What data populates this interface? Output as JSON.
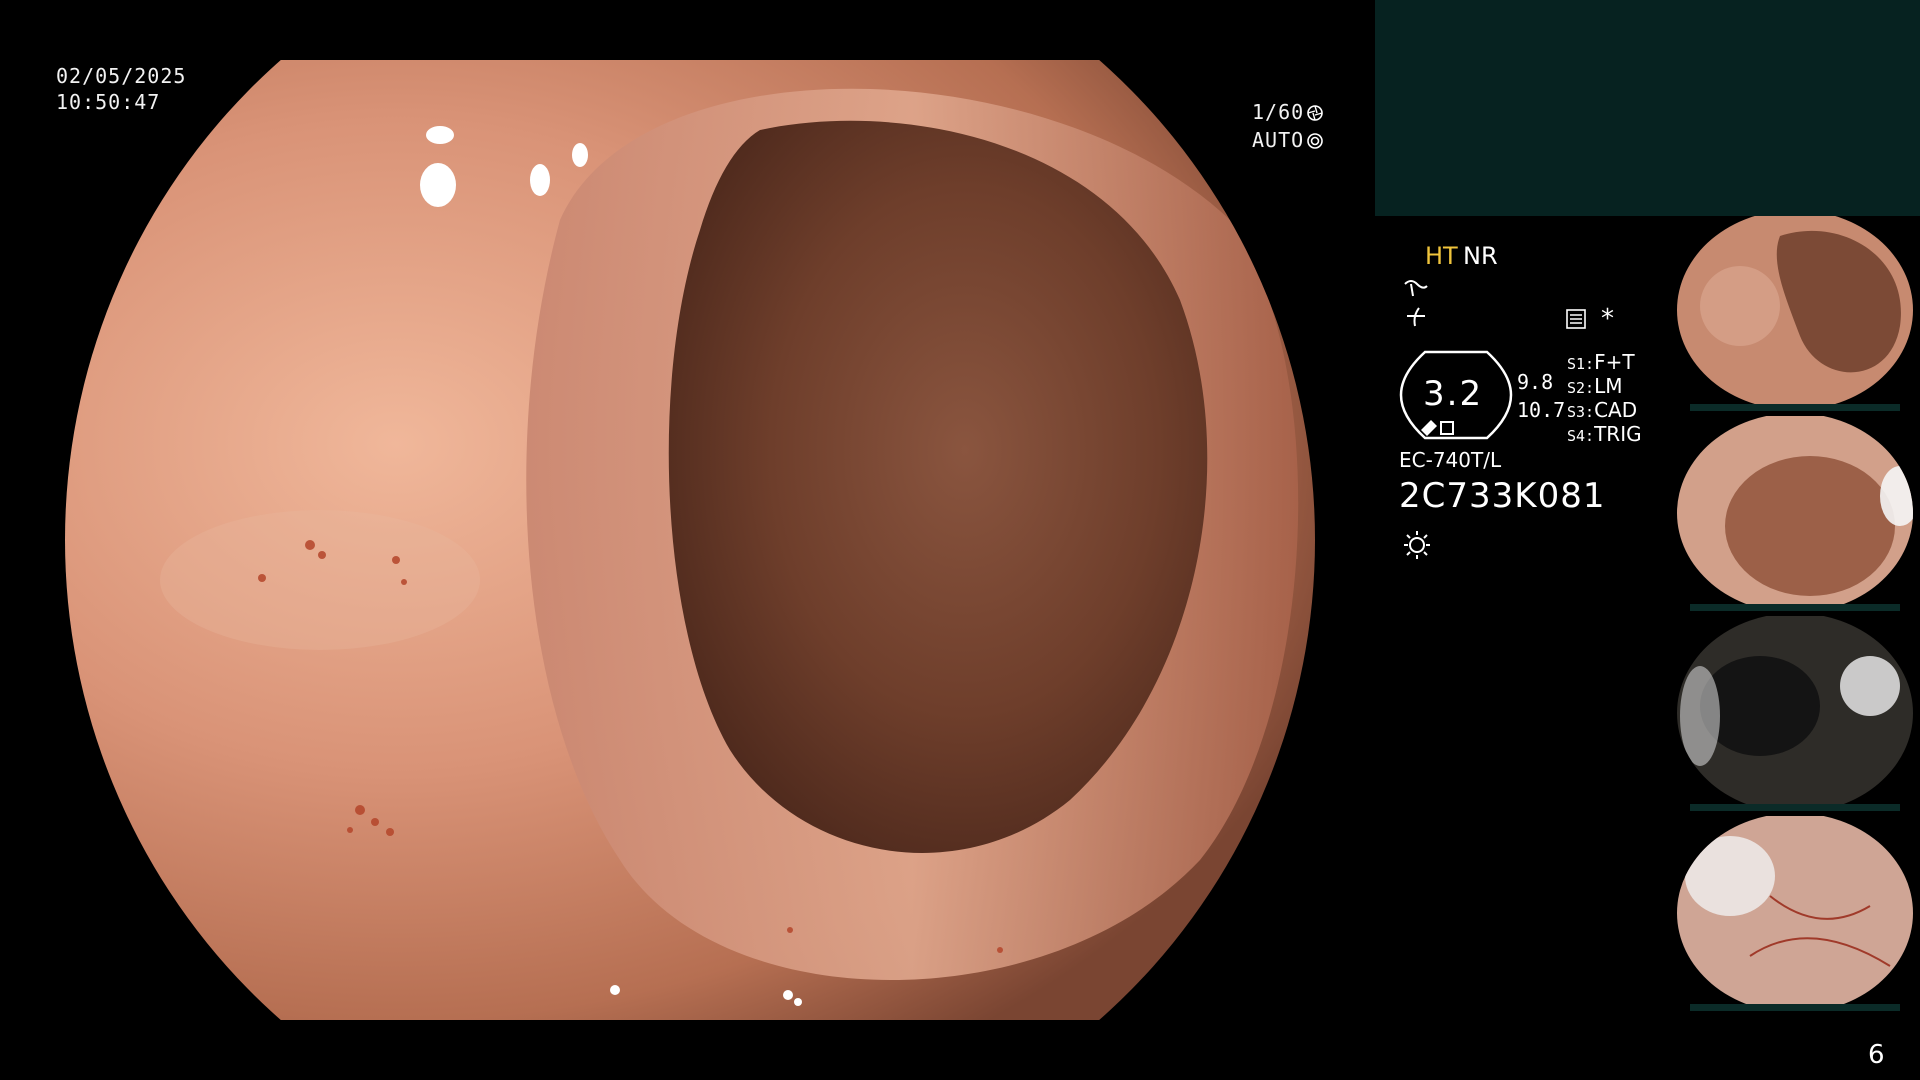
{
  "overlay": {
    "date": "02/05/2025",
    "time": "10:50:47",
    "shutter": "1/60",
    "shutter_mode": "AUTO"
  },
  "info_panel": {
    "ht_label": "HT",
    "nr_label": "NR",
    "asterisk": "*",
    "zoom_value": "3.2",
    "value_a": "9.8",
    "value_b": "10.7",
    "switches": [
      {
        "key": "S1:",
        "value": "F+T"
      },
      {
        "key": "S2:",
        "value": "LM"
      },
      {
        "key": "S3:",
        "value": "CAD"
      },
      {
        "key": "S4:",
        "value": "TRIG"
      }
    ],
    "scope_model": "EC-740T/L",
    "scope_serial": "2C733K081"
  },
  "icons": {
    "shutter": "aperture-icon",
    "auto_mode": "iris-icon",
    "enhance_1": "structure-enhancement-icon",
    "enhance_2": "color-enhancement-icon",
    "image_mode": "image-mode-icon",
    "light": "light-source-icon"
  },
  "thumbnails": [
    {
      "name": "capture-1"
    },
    {
      "name": "capture-2"
    },
    {
      "name": "capture-3"
    },
    {
      "name": "capture-4"
    }
  ],
  "colors": {
    "top_panel": "#062220",
    "ht_accent": "#f0c43c",
    "tissue": "#c98b6d",
    "lumen": "#6f3f2c"
  },
  "page_number": "6"
}
